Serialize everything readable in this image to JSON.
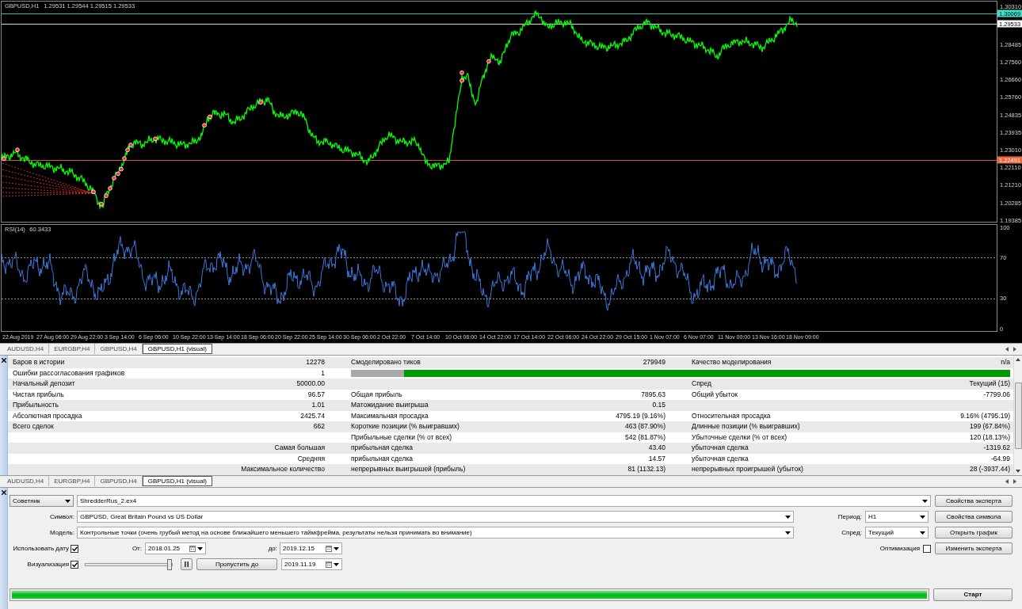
{
  "chart": {
    "symbol": "GBPUSD,H1",
    "quote": "1.29531 1.29544 1.29515 1.29533",
    "price_ticks": [
      "1.30310",
      "1.28485",
      "1.27560",
      "1.26660",
      "1.25760",
      "1.24835",
      "1.23935",
      "1.23010",
      "1.22110",
      "1.21210",
      "1.20285",
      "1.19385"
    ],
    "price_levels": [
      {
        "label": "1.30069",
        "color": "#40e0c8"
      },
      {
        "label": "1.29533",
        "color": "#ffffff"
      },
      {
        "label": "1.22491",
        "color": "#f0643c"
      }
    ],
    "indicator": {
      "name": "RSI(14)",
      "value": "60.3433",
      "ticks": [
        "100",
        "70",
        "30",
        "0"
      ]
    },
    "time_ticks": [
      "22 Aug 2019",
      "27 Aug 06:00",
      "29 Aug 22:00",
      "3 Sep 14:00",
      "6 Sep 06:00",
      "10 Sep 22:00",
      "13 Sep 14:00",
      "18 Sep 06:00",
      "20 Sep 22:00",
      "25 Sep 14:00",
      "30 Sep 06:00",
      "2 Oct 22:00",
      "7 Oct 14:00",
      "10 Oct 06:00",
      "14 Oct 22:00",
      "17 Oct 14:00",
      "22 Oct 06:00",
      "24 Oct 22:00",
      "29 Oct 15:00",
      "1 Nov 07:00",
      "6 Nov 07:00",
      "11 Nov 00:00",
      "13 Nov 16:00",
      "18 Nov 09:00"
    ]
  },
  "chart_tabs": [
    {
      "label": "AUDUSD,H4",
      "selected": false
    },
    {
      "label": "EURGBP,H4",
      "selected": false
    },
    {
      "label": "GBPUSD,H4",
      "selected": false
    },
    {
      "label": "GBPUSD,H1 (visual)",
      "selected": true
    }
  ],
  "report": {
    "rows": [
      {
        "label": "Баров в истории",
        "value": "12278",
        "label_2": "Смоделировано тиков",
        "value_2": "279949",
        "label_3": "Качество моделирования",
        "value_3": "n/a"
      },
      {
        "label": "Ошибки рассогласования графиков",
        "value": "1",
        "quality_bar": {
          "level": 0.92
        }
      },
      {
        "label": "Начальный депозит",
        "value": "50000.00",
        "label_3": "Спред",
        "value_3": "Текущий (15)"
      },
      {
        "label": "Чистая прибыль",
        "value": "96.57",
        "label_2": "Общая прибыль",
        "value_2": "7895.63",
        "label_3": "Общий убыток",
        "value_3": "-7799.06"
      },
      {
        "label": "Прибыльность",
        "value": "1.01",
        "label_2": "Матожидание выигрыша",
        "value_2": "0.15"
      },
      {
        "label": "Абсолютная просадка",
        "value": "2425.74",
        "label_2": "Максимальная просадка",
        "value_2": "4795.19 (9.16%)",
        "label_3": "Относительная просадка",
        "value_3": "9.16% (4795.19)"
      },
      {
        "label": "Всего сделок",
        "value": "662",
        "label_2": "Короткие позиции (% выигравших)",
        "value_2": "463 (87.90%)",
        "label_3": "Длинные позиции (% выигравших)",
        "value_3": "199 (67.84%)"
      },
      {
        "label_2": "Прибыльные сделки (% от всех)",
        "value_2": "542 (81.87%)",
        "label_3": "Убыточные сделки (% от всех)",
        "value_3": "120 (18.13%)"
      },
      {
        "row_group": "Самая большая",
        "label_2": "прибыльная сделка",
        "value_2": "43.40",
        "label_3": "убыточная сделка",
        "value_3": "-1319.62"
      },
      {
        "row_group": "Средняя",
        "label_2": "прибыльная сделка",
        "value_2": "14.57",
        "label_3": "убыточная сделка",
        "value_3": "-64.99"
      },
      {
        "row_group": "Максимальное количество",
        "label_2": "непрерывных выигрышей (прибыль)",
        "value_2": "81 (1132.13)",
        "label_3": "непрерывных проигрышей (убыток)",
        "value_3": "28 (-3937.44)"
      }
    ]
  },
  "report_tabs": [
    {
      "label": "AUDUSD,H4",
      "selected": false
    },
    {
      "label": "EURGBP,H4",
      "selected": false
    },
    {
      "label": "GBPUSD,H4",
      "selected": false
    },
    {
      "label": "GBPUSD,H1 (visual)",
      "selected": true
    }
  ],
  "settings": {
    "program_type": "Советник",
    "expert_file": "ShredderRus_2.ex4",
    "symbol": {
      "label": "Символ:",
      "value": "GBPUSD, Great Britain Pound vs US Dollar"
    },
    "period": {
      "label": "Период:",
      "value": "H1"
    },
    "model": {
      "label": "Модель:",
      "value": "Контрольные точки (очень грубый метод на основе ближайшего меньшего таймфрейма, результаты нельзя принимать во внимание)"
    },
    "spread": {
      "label": "Спред:",
      "value": "Текущий"
    },
    "use_date": {
      "label": "Использовать дату",
      "checked": true
    },
    "from": {
      "label": "От:",
      "value": "2018.01.25"
    },
    "to": {
      "label": "до:",
      "value": "2019.12.15"
    },
    "optimization": {
      "label": "Оптимизация",
      "checked": false
    },
    "visualization": {
      "label": "Визуализация",
      "checked": true
    },
    "speed_slider": {
      "level": 1
    },
    "skip_to": {
      "button": "Пропустить до",
      "value": "2019.11.19"
    },
    "buttons": [
      "Свойства эксперта",
      "Свойства символа",
      "Открыть график",
      "Изменить эксперта"
    ],
    "progress": {
      "level": 1
    },
    "start_button": "Старт"
  }
}
